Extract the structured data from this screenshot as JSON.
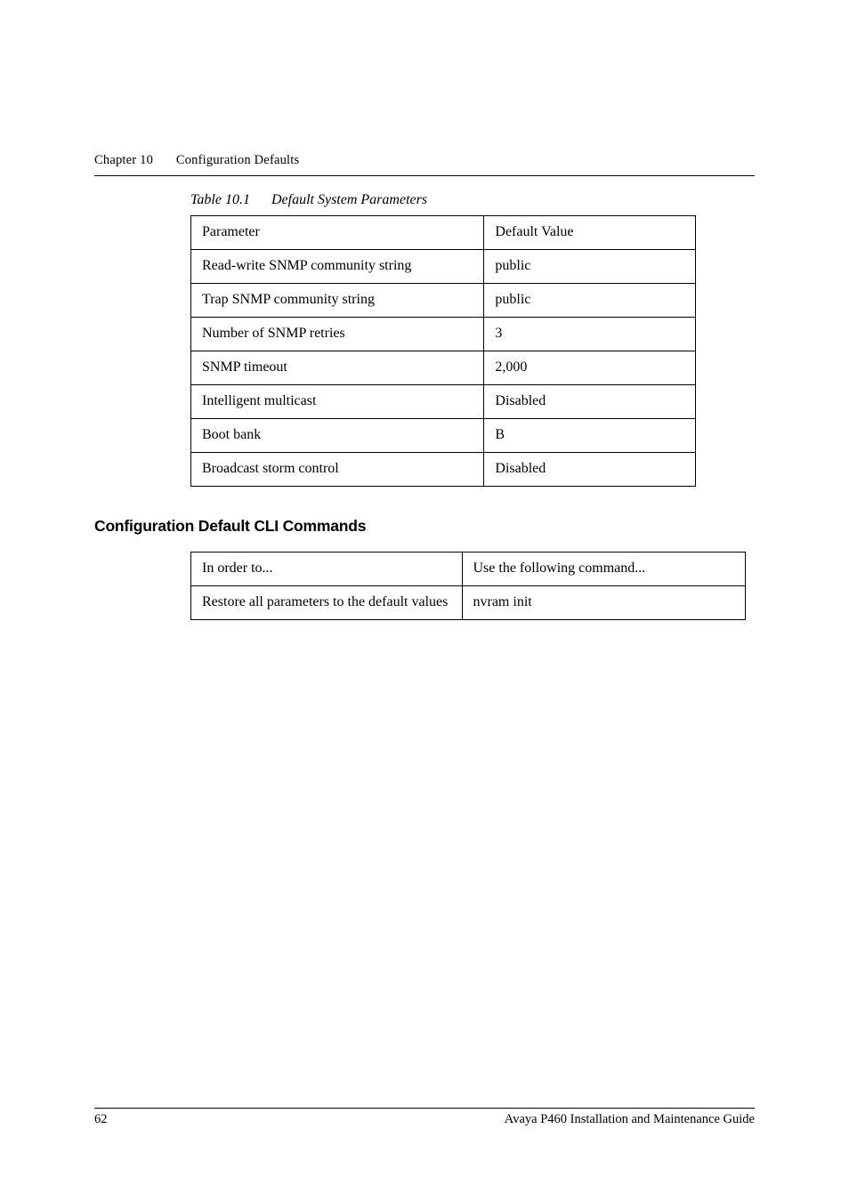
{
  "running_head": {
    "chapter": "Chapter 10",
    "title": "Configuration Defaults"
  },
  "table1": {
    "caption_label": "Table 10.1",
    "caption_text": "Default System Parameters",
    "header": {
      "param": "Parameter",
      "value": "Default Value"
    },
    "rows": [
      {
        "param": "Read-write SNMP community string",
        "value": "public"
      },
      {
        "param": "Trap SNMP community string",
        "value": "public"
      },
      {
        "param": "Number of SNMP retries",
        "value": "3"
      },
      {
        "param": "SNMP timeout",
        "value": "2,000"
      },
      {
        "param": "Intelligent multicast",
        "value": "Disabled"
      },
      {
        "param": "Boot bank",
        "value": "B"
      },
      {
        "param": "Broadcast storm control",
        "value": "Disabled"
      }
    ]
  },
  "section_heading": "Configuration Default CLI Commands",
  "table2": {
    "header": {
      "left": "In order to...",
      "right": "Use the following command..."
    },
    "rows": [
      {
        "left": "Restore all parameters to the default values",
        "right": "nvram init"
      }
    ]
  },
  "footer": {
    "page_number": "62",
    "book_title": "Avaya P460 Installation and Maintenance Guide"
  }
}
